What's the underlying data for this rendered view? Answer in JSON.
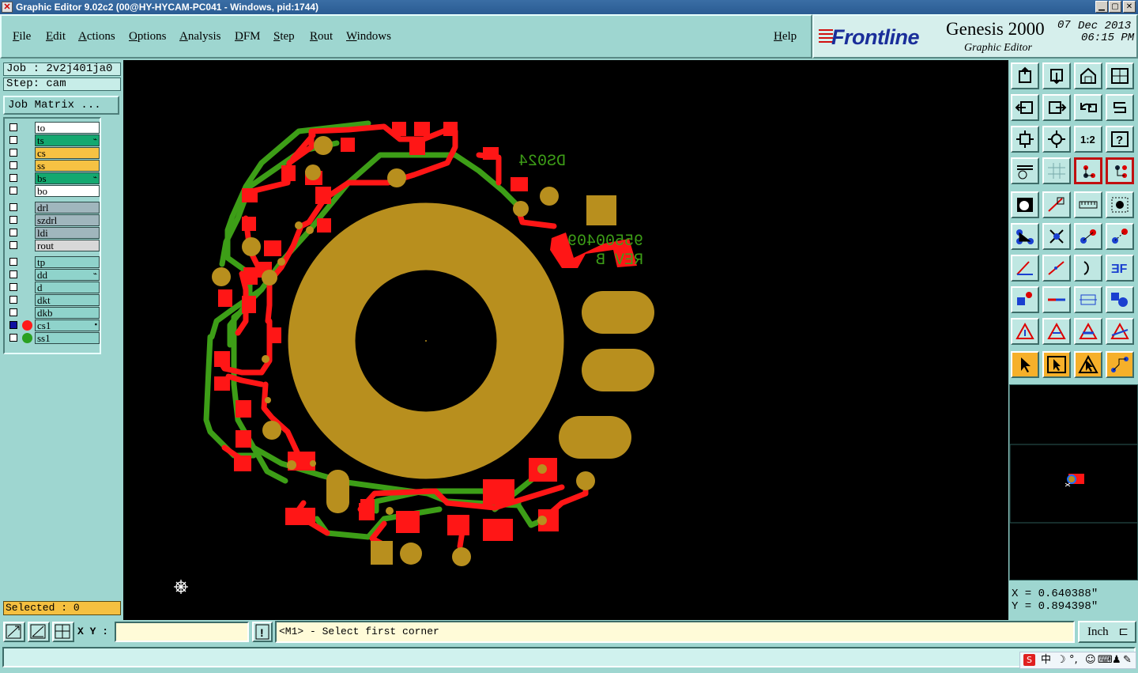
{
  "window": {
    "title": "Graphic Editor 9.02c2 (00@HY-HYCAM-PC041 - Windows, pid:1744)",
    "controls": [
      "minimize",
      "maximize",
      "close"
    ]
  },
  "menu": {
    "items": [
      "File",
      "Edit",
      "Actions",
      "Options",
      "Analysis",
      "DFM",
      "Step",
      "Rout",
      "Windows"
    ],
    "help": "Help"
  },
  "brand": {
    "logo": "Frontline",
    "product": "Genesis 2000",
    "subtitle": "Graphic Editor",
    "date_day": "07",
    "date_month_year": "Dec 2013",
    "time": "06:15 PM"
  },
  "left": {
    "job": "Job : 2v2j401ja0",
    "step": "Step: cam",
    "job_matrix": "Job Matrix ...",
    "layers": [
      {
        "name": "to",
        "fill": "#ffffff"
      },
      {
        "name": "ts",
        "fill": "#14a870",
        "marked": true
      },
      {
        "name": "cs",
        "fill": "#f6c243"
      },
      {
        "name": "ss",
        "fill": "#f6c243"
      },
      {
        "name": "bs",
        "fill": "#14a870",
        "marked": true
      },
      {
        "name": "bo",
        "fill": "#ffffff"
      },
      {
        "name": "drl",
        "fill": "#a0b6bd"
      },
      {
        "name": "szdrl",
        "fill": "#a0b6bd"
      },
      {
        "name": "ldi",
        "fill": "#a0b6bd"
      },
      {
        "name": "rout",
        "fill": "#d8d8d8"
      },
      {
        "name": "tp",
        "fill": "#8fd3cb"
      },
      {
        "name": "dd",
        "fill": "#8fd3cb",
        "marked": true
      },
      {
        "name": "d",
        "fill": "#8fd3cb"
      },
      {
        "name": "dkt",
        "fill": "#8fd3cb"
      },
      {
        "name": "dkb",
        "fill": "#8fd3cb"
      },
      {
        "name": "cs1",
        "fill": "#8fd3cb",
        "dot": "#ff1a1a",
        "selected": true,
        "marked": true
      },
      {
        "name": "ss1",
        "fill": "#8fd3cb",
        "dot": "#2aa020"
      }
    ],
    "selected": "Selected : 0"
  },
  "board": {
    "silk_text_1": "DS024",
    "silk_text_2": "95500409",
    "silk_text_3": "REV B",
    "colors": {
      "copper_cs": "#ff1616",
      "copper_ss": "#3d9e17",
      "pad_overlap": "#b88f1e"
    }
  },
  "coords": {
    "x": "X = 0.640388\"",
    "y": "Y = 0.894398\""
  },
  "bottom": {
    "xy_label": "X Y :",
    "xy_value": "",
    "prompt": "<M1> - Select first corner",
    "unit": "Inch",
    "excl": "!"
  },
  "ime": {
    "label": "中"
  }
}
